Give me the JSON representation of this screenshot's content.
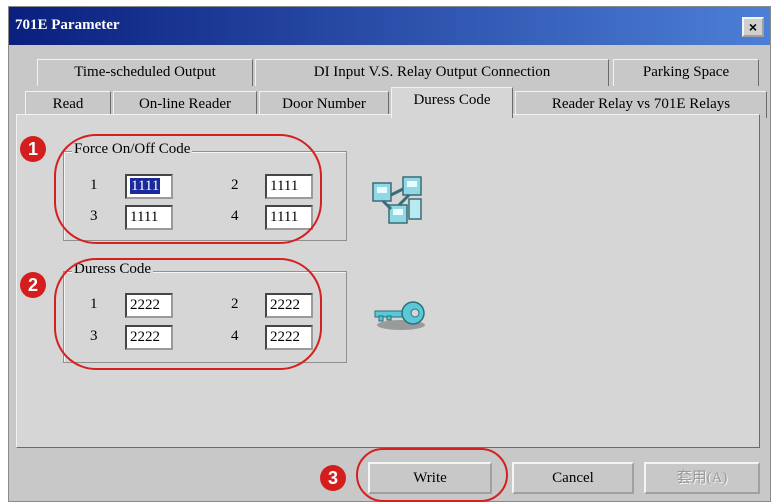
{
  "window": {
    "title": "701E Parameter",
    "close_label": "×"
  },
  "tabs_row1": [
    {
      "label": "Time-scheduled Output"
    },
    {
      "label": "DI Input  V.S. Relay Output Connection"
    },
    {
      "label": "Parking Space"
    }
  ],
  "tabs_row2": [
    {
      "label": "Read"
    },
    {
      "label": "On-line Reader"
    },
    {
      "label": "Door Number"
    },
    {
      "label": "Duress Code"
    },
    {
      "label": "Reader Relay vs 701E Relays"
    }
  ],
  "force_group": {
    "title": "Force On/Off Code",
    "fields": [
      {
        "label": "1",
        "value": "1111"
      },
      {
        "label": "2",
        "value": "1111"
      },
      {
        "label": "3",
        "value": "1111"
      },
      {
        "label": "4",
        "value": "1111"
      }
    ]
  },
  "duress_group": {
    "title": "Duress Code",
    "fields": [
      {
        "label": "1",
        "value": "2222"
      },
      {
        "label": "2",
        "value": "2222"
      },
      {
        "label": "3",
        "value": "2222"
      },
      {
        "label": "4",
        "value": "2222"
      }
    ]
  },
  "buttons": {
    "write": "Write",
    "cancel": "Cancel",
    "apply": "套用(A)"
  },
  "annotations": [
    "1",
    "2",
    "3"
  ],
  "icons": {
    "force": "network-blocks-icon",
    "duress": "key-icon"
  },
  "colors": {
    "titlebar_start": "#0a1f7e",
    "titlebar_end": "#4c7fd6",
    "annotation_red": "#d42020"
  }
}
